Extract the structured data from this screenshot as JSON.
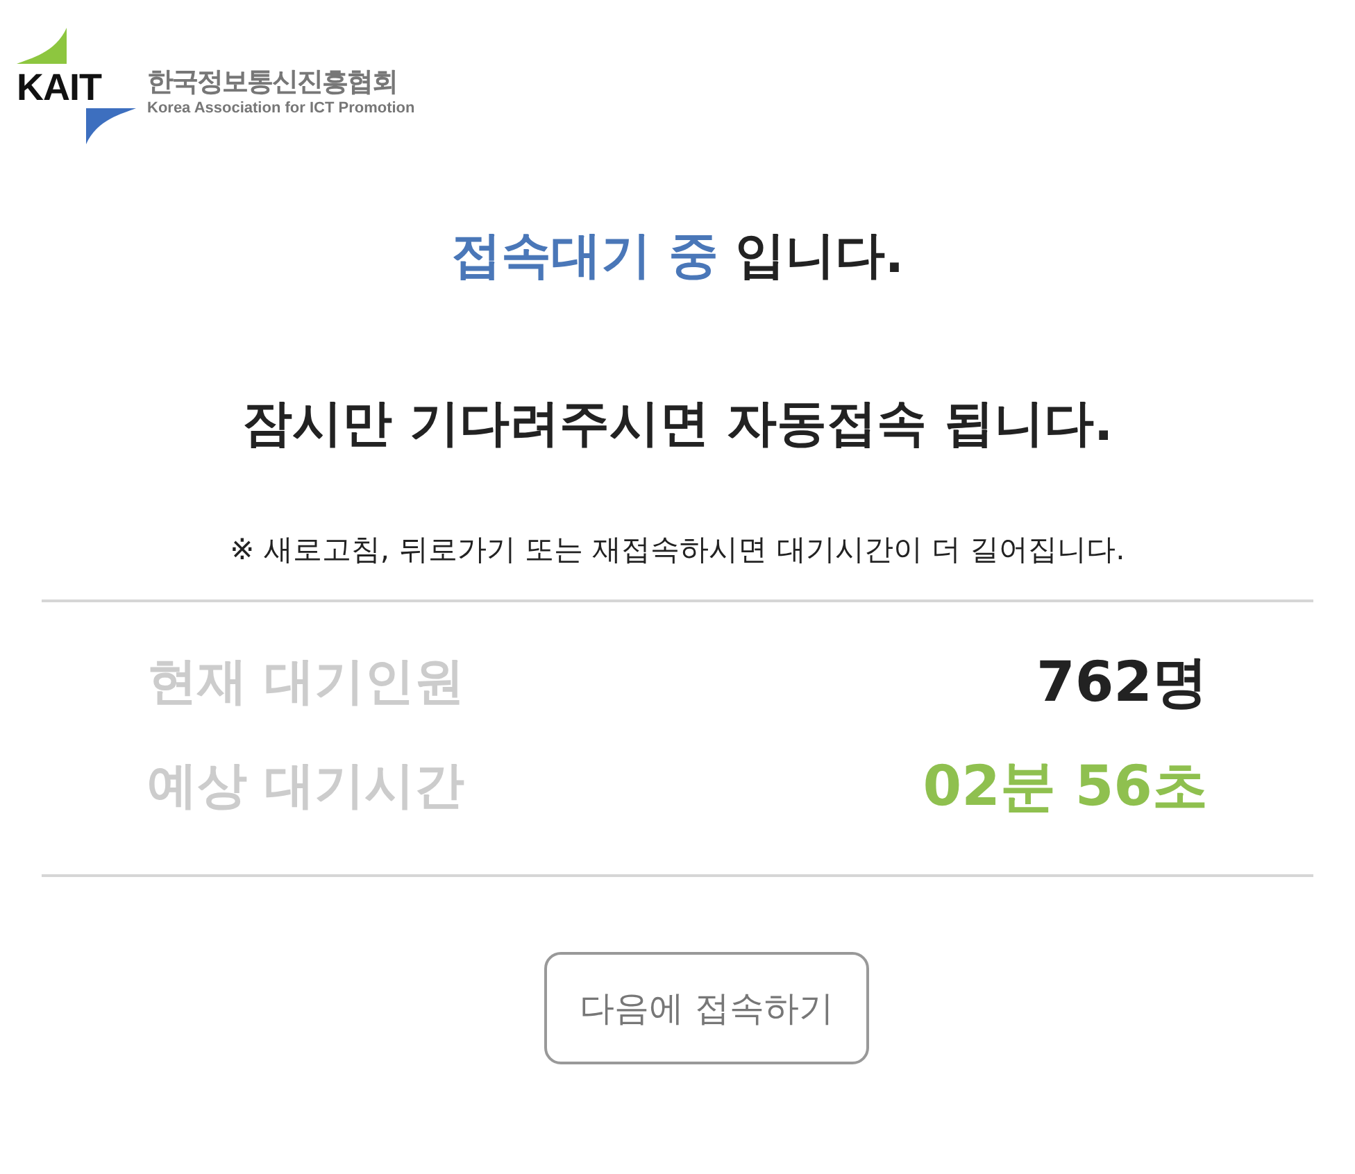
{
  "logo": {
    "mark": "KAIT",
    "name_ko": "한국정보통신진흥협회",
    "name_en": "Korea Association for ICT Promotion"
  },
  "heading": {
    "highlight": "접속대기 중",
    "rest": "입니다."
  },
  "subheading": "잠시만 기다려주시면 자동접속 됩니다.",
  "notice": "※ 새로고침, 뒤로가기 또는 재접속하시면 대기시간이 더 길어집니다.",
  "stats": [
    {
      "label": "현재 대기인원",
      "value": "762명",
      "kind": "count"
    },
    {
      "label": "예상 대기시간",
      "value": "02분 56초",
      "kind": "time"
    }
  ],
  "button": "다음에 접속하기"
}
